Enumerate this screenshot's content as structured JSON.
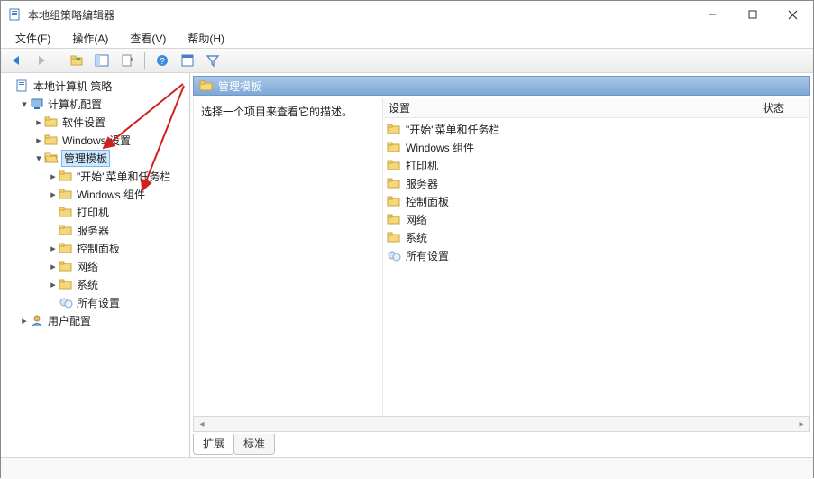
{
  "window": {
    "title": "本地组策略编辑器"
  },
  "menu": {
    "file": "文件(F)",
    "action": "操作(A)",
    "view": "查看(V)",
    "help": "帮助(H)"
  },
  "tree": {
    "root": "本地计算机 策略",
    "computer_config": "计算机配置",
    "software_settings": "软件设置",
    "windows_settings": "Windows 设置",
    "admin_templates": "管理模板",
    "start_taskbar": "\"开始\"菜单和任务栏",
    "windows_components": "Windows 组件",
    "printers": "打印机",
    "servers": "服务器",
    "control_panel": "控制面板",
    "network": "网络",
    "system": "系统",
    "all_settings": "所有设置",
    "user_config": "用户配置"
  },
  "content": {
    "header": "管理模板",
    "description_prompt": "选择一个项目来查看它的描述。",
    "col_setting": "设置",
    "col_status": "状态",
    "items": {
      "start_taskbar": "\"开始\"菜单和任务栏",
      "windows_components": "Windows 组件",
      "printers": "打印机",
      "servers": "服务器",
      "control_panel": "控制面板",
      "network": "网络",
      "system": "系统",
      "all_settings": "所有设置"
    }
  },
  "tabs": {
    "extended": "扩展",
    "standard": "标准"
  }
}
